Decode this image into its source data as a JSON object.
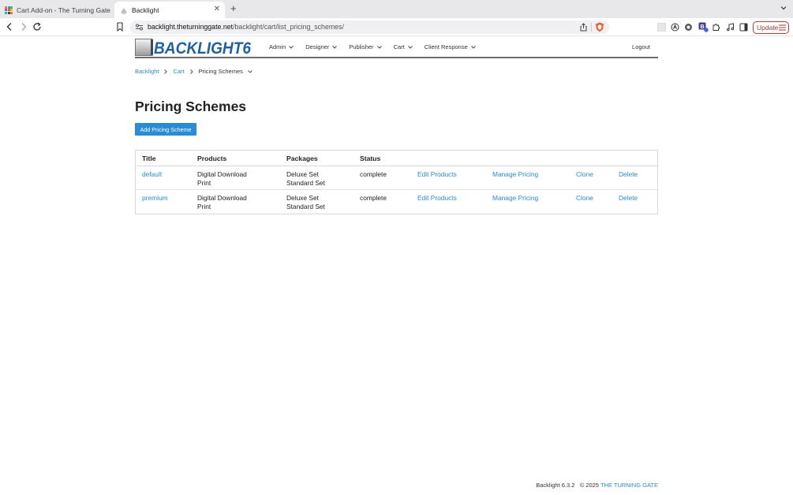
{
  "browser": {
    "tabs": [
      {
        "label": "Cart Add-on - The Turning Gate",
        "active": false
      },
      {
        "label": "Backlight",
        "active": true
      }
    ],
    "url_host": "backlight.theturninggate.net",
    "url_path": "/backlight/cart/list_pricing_schemes/",
    "update_label": "Update",
    "accent_color": "#c0392b"
  },
  "header": {
    "logo_text": "BACKLIGHT6",
    "nav": [
      {
        "label": "Admin"
      },
      {
        "label": "Designer"
      },
      {
        "label": "Publisher"
      },
      {
        "label": "Cart"
      },
      {
        "label": "Client Response"
      }
    ],
    "logout_label": "Logout"
  },
  "breadcrumb": {
    "items": [
      "Backlight",
      "Cart"
    ],
    "current": "Pricing Schemes"
  },
  "main": {
    "title": "Pricing Schemes",
    "add_button_label": "Add Pricing Scheme",
    "link_color": "#2a8bd6",
    "table": {
      "headers": [
        "Title",
        "Products",
        "Packages",
        "Status"
      ],
      "rows": [
        {
          "title": "default",
          "products": [
            "Digital Download",
            "Print"
          ],
          "packages": [
            "Deluxe Set",
            "Standard Set"
          ],
          "status": "complete",
          "actions": [
            "Edit Products",
            "Manage Pricing",
            "Clone",
            "Delete"
          ]
        },
        {
          "title": "premium",
          "products": [
            "Digital Download",
            "Print"
          ],
          "packages": [
            "Deluxe Set",
            "Standard Set"
          ],
          "status": "complete",
          "actions": [
            "Edit Products",
            "Manage Pricing",
            "Clone",
            "Delete"
          ]
        }
      ]
    }
  },
  "footer": {
    "version": "Backlight 6.3.2",
    "copyright": "© 2025",
    "company": "THE TURNING GATE"
  }
}
